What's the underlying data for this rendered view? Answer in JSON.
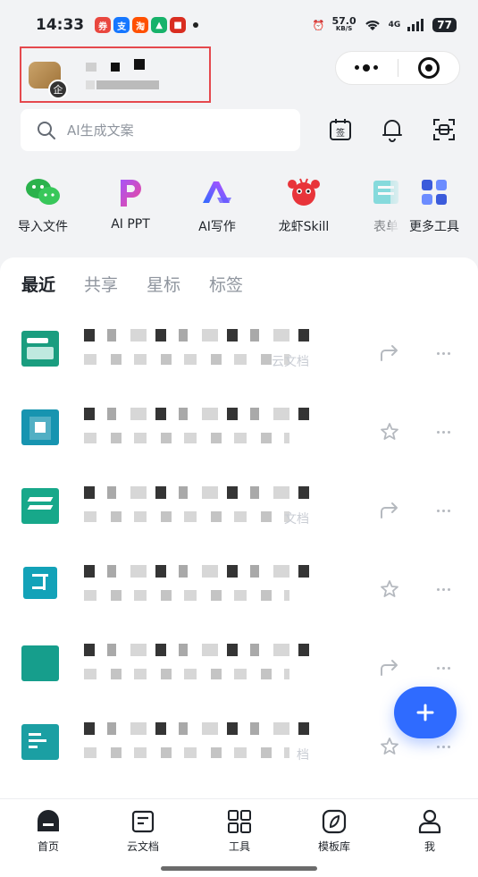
{
  "status_bar": {
    "time": "14:33",
    "speed_value": "57.0",
    "speed_unit": "KB/S",
    "network": "4G",
    "battery": "77",
    "notification_apps": [
      "app-1",
      "app-2",
      "app-3",
      "app-4",
      "app-5"
    ]
  },
  "search": {
    "placeholder": "AI生成文案"
  },
  "shortcuts": [
    {
      "label": "导入文件",
      "icon": "wechat-icon"
    },
    {
      "label": "AI PPT",
      "icon": "ai-ppt-icon"
    },
    {
      "label": "AI写作",
      "icon": "ai-writing-icon"
    },
    {
      "label": "龙虾Skill",
      "icon": "lobster-icon"
    },
    {
      "label": "表单",
      "icon": "form-icon"
    },
    {
      "label": "更多工具",
      "icon": "grid-icon"
    }
  ],
  "tabs": [
    {
      "label": "最近",
      "active": true
    },
    {
      "label": "共享",
      "active": false
    },
    {
      "label": "星标",
      "active": false
    },
    {
      "label": "标签",
      "active": false
    }
  ],
  "documents": [
    {
      "icon_color": "#1a9d7f",
      "action": "share",
      "hint": "云文档"
    },
    {
      "icon_color": "#1794b0",
      "action": "star",
      "hint": ""
    },
    {
      "icon_color": "#17a88a",
      "action": "share",
      "hint": "文档"
    },
    {
      "icon_color": "#13a2b8",
      "action": "star",
      "hint": ""
    },
    {
      "icon_color": "#169e8c",
      "action": "share",
      "hint": ""
    },
    {
      "icon_color": "#1b9fa3",
      "action": "star",
      "hint": "档"
    }
  ],
  "bottom_nav": [
    {
      "label": "首页",
      "icon": "home-icon"
    },
    {
      "label": "云文档",
      "icon": "cloud-doc-icon"
    },
    {
      "label": "工具",
      "icon": "tools-icon"
    },
    {
      "label": "模板库",
      "icon": "template-icon"
    },
    {
      "label": "我",
      "icon": "profile-icon"
    }
  ],
  "enterprise_badge": "企"
}
